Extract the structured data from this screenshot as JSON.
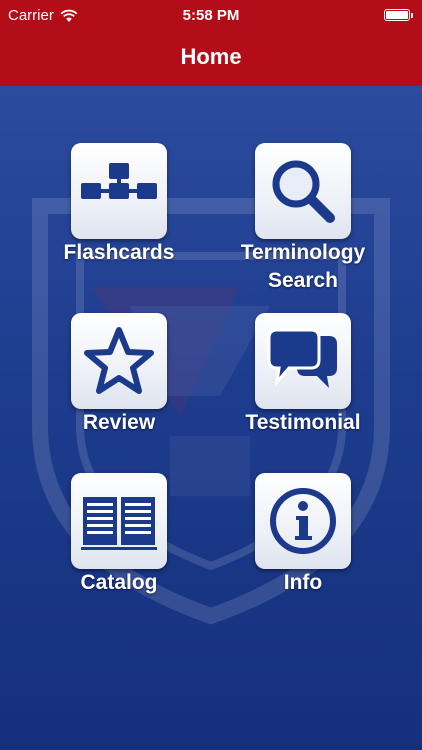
{
  "status_bar": {
    "carrier": "Carrier",
    "time": "5:58 PM",
    "wifi_icon": "wifi-icon",
    "battery_icon": "battery-full-icon"
  },
  "nav": {
    "title": "Home"
  },
  "colors": {
    "header": "#b30d18",
    "background": "#1e3c8e",
    "icon_blue": "#1b3a8c",
    "tile_bg": "#ffffff"
  },
  "menu": {
    "flashcards": {
      "label": "Flashcards",
      "icon": "hierarchy-icon"
    },
    "terminology": {
      "label_line1": "Terminology",
      "label_line2": "Search",
      "icon": "search-icon"
    },
    "review": {
      "label": "Review",
      "icon": "star-icon"
    },
    "testimonial": {
      "label": "Testimonial",
      "icon": "chat-bubbles-icon"
    },
    "catalog": {
      "label": "Catalog",
      "icon": "open-book-icon"
    },
    "info": {
      "label": "Info",
      "icon": "info-icon"
    }
  }
}
